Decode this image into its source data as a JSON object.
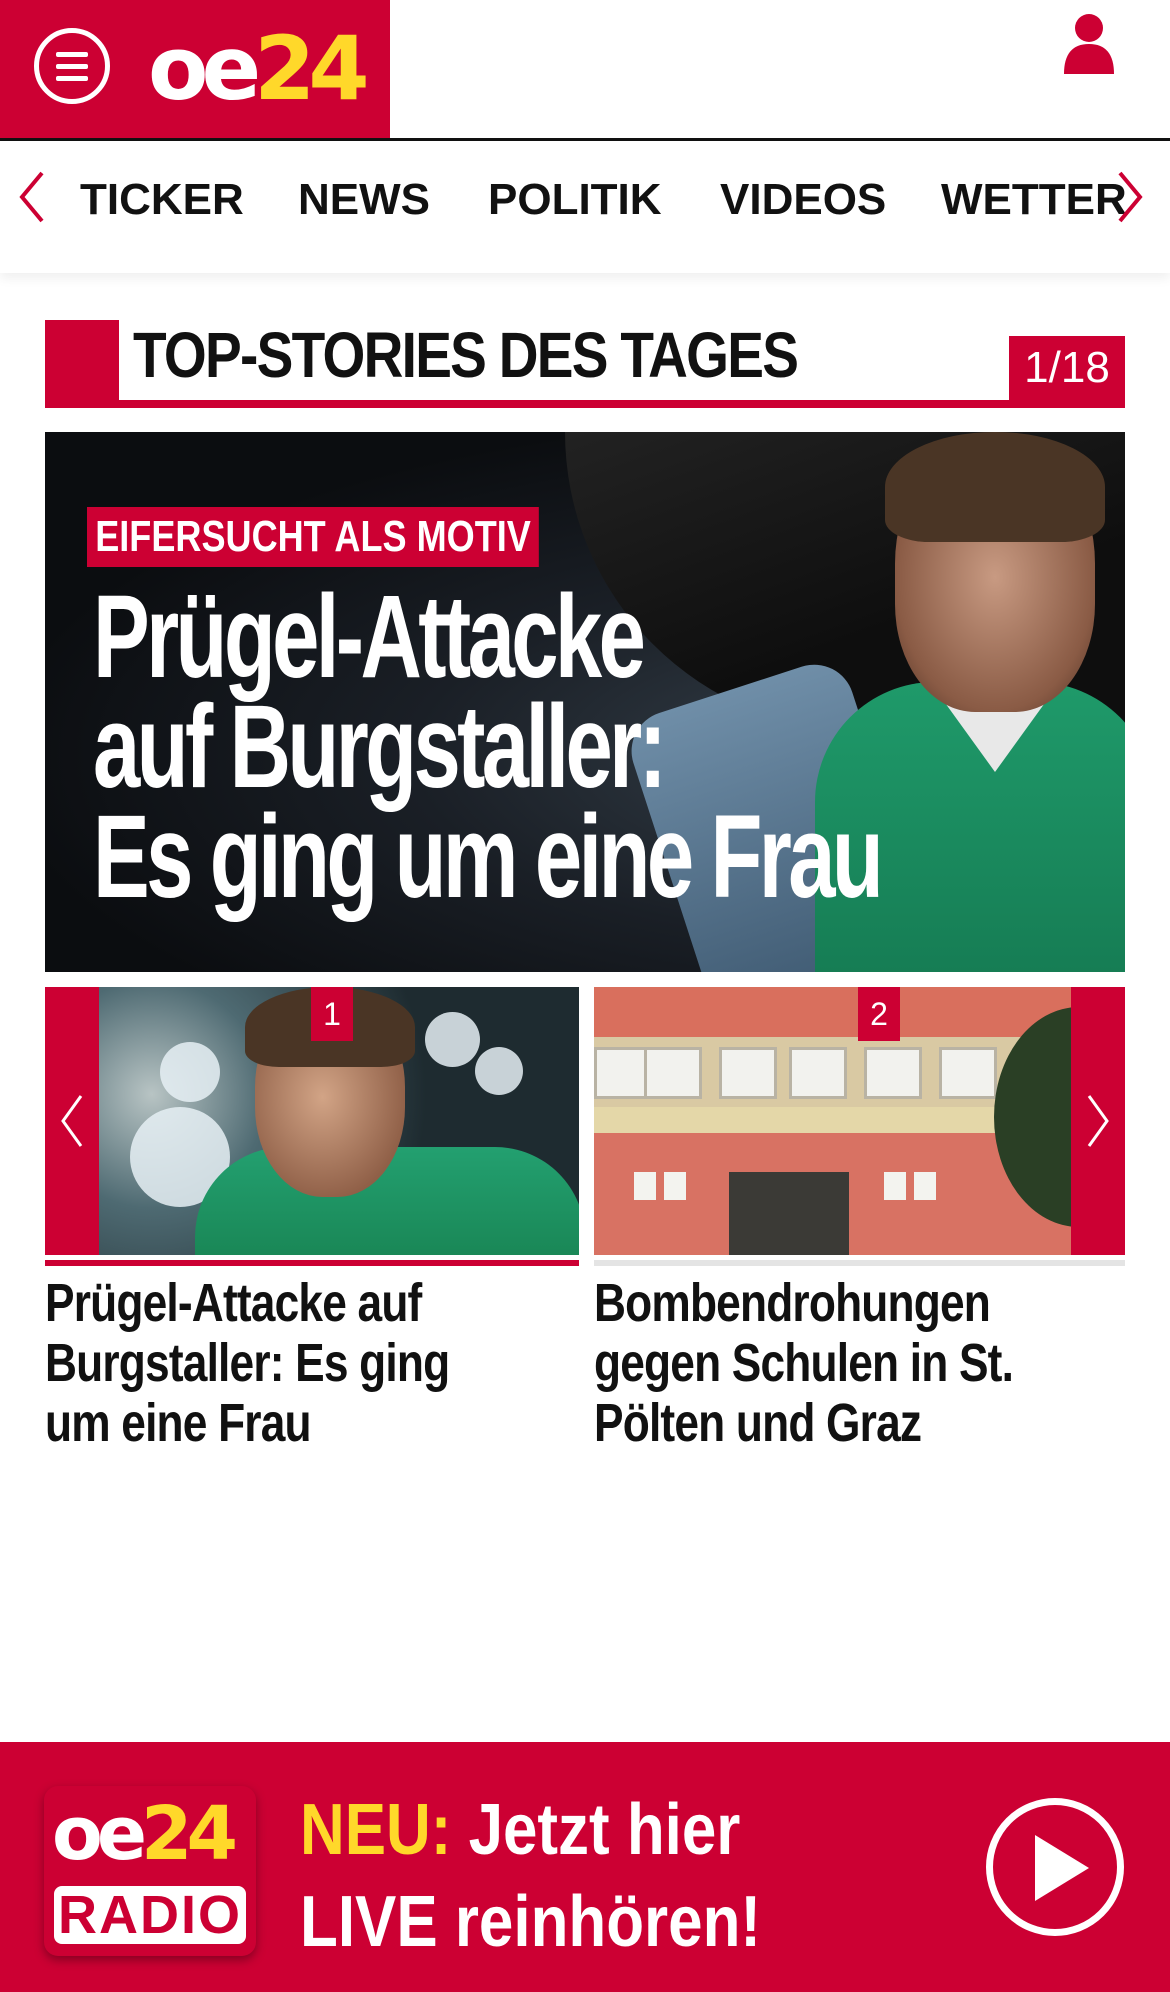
{
  "header": {
    "logo_oe": "oe",
    "logo_24": "24",
    "menu_icon": "hamburger-menu-icon",
    "user_icon": "user-account-icon"
  },
  "nav": {
    "items": [
      "TICKER",
      "NEWS",
      "POLITIK",
      "VIDEOS",
      "WETTER"
    ],
    "left_arrow_icon": "chevron-left-icon",
    "right_arrow_icon": "chevron-right-icon"
  },
  "section": {
    "title": "TOP-STORIES DES TAGES",
    "counter": "1/18"
  },
  "hero": {
    "tag": "EIFERSUCHT ALS MOTIV",
    "headline_lines": [
      "Prügel-Attacke",
      "auf Burgstaller:",
      "Es ging um eine Frau"
    ]
  },
  "stories": [
    {
      "badge": "1",
      "title": "Prügel-Attacke auf Burgstaller: Es ging um eine Frau"
    },
    {
      "badge": "2",
      "title": "Bombendrohungen gegen Schulen in St. Pölten und Graz"
    }
  ],
  "radio": {
    "logo_oe": "oe",
    "logo_24": "24",
    "logo_radio": "RADIO",
    "neu": "NEU:",
    "line1_rest": " Jetzt hier",
    "line2": "LIVE reinhören!",
    "play_icon": "play-icon"
  },
  "colors": {
    "brand_red": "#cc0033",
    "brand_yellow": "#ffd82a"
  }
}
